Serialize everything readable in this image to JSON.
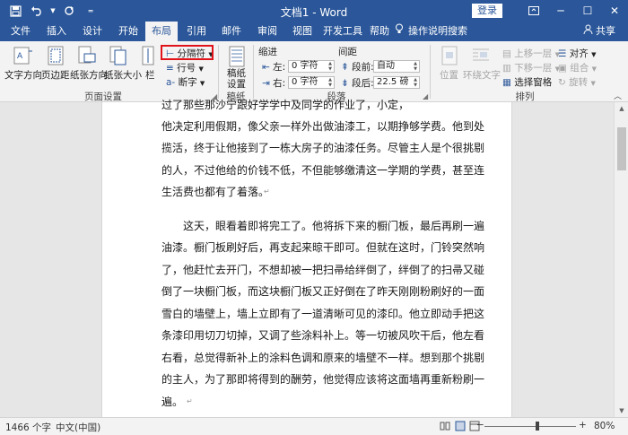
{
  "window": {
    "title": "文档1 - Word",
    "login_label": "登录"
  },
  "tabs": [
    {
      "label": "文件"
    },
    {
      "label": "插入"
    },
    {
      "label": "设计"
    },
    {
      "label": "开始"
    },
    {
      "label": "布局"
    },
    {
      "label": "引用"
    },
    {
      "label": "邮件"
    },
    {
      "label": "审阅"
    },
    {
      "label": "视图"
    },
    {
      "label": "开发工具"
    },
    {
      "label": "帮助"
    }
  ],
  "active_tab": "布局",
  "tell_me": "操作说明搜索",
  "share_label": "共享",
  "ribbon": {
    "page_setup": {
      "text_direction": "文字方向",
      "margins": "页边距",
      "orientation": "纸张方向",
      "size": "纸张大小",
      "columns": "栏",
      "breaks": "分隔符",
      "line_numbers": "行号",
      "hyphenation": "断字",
      "group_label": "页面设置"
    },
    "manuscript": {
      "button": "稿纸设置",
      "group_label": "稿纸"
    },
    "paragraph": {
      "indent_title": "缩进",
      "spacing_title": "间距",
      "left_label": "左:",
      "left_value": "0 字符",
      "right_label": "右:",
      "right_value": "0 字符",
      "before_label": "段前:",
      "before_value": "自动",
      "after_label": "段后:",
      "after_value": "22.5 磅",
      "group_label": "段落"
    },
    "arrange": {
      "position": "位置",
      "wrap_text": "环绕文字",
      "bring_forward": "上移一层",
      "send_backward": "下移一层",
      "selection_pane": "选择窗格",
      "align": "对齐",
      "group": "组合",
      "rotate": "旋转",
      "group_label": "排列"
    }
  },
  "document": {
    "lines": [
      "过了那些那沙宁跟好学学中及同学的作业了，小定，",
      "他决定利用假期，像父亲一样外出做油漆工，以期挣够学费。他到处",
      "揽活，终于让他接到了一栋大房子的油漆任务。尽管主人是个很挑剔",
      "的人，不过他给的价钱不低，不但能够缴清这一学期的学费，甚至连",
      "生活费也都有了着落。",
      "这天，眼看着即将完工了。他将拆下来的橱门板，最后再刷一遍",
      "油漆。橱门板刷好后，再支起来晾干即可。但就在这时，门铃突然响",
      "了，他赶忙去开门，不想却被一把扫帚给绊倒了，绊倒了的扫帚又碰",
      "倒了一块橱门板，而这块橱门板又正好倒在了昨天刚刚粉刷好的一面",
      "雪白的墙壁上，墙上立即有了一道清晰可见的漆印。他立即动手把这",
      "条漆印用切刀切掉，又调了些涂料补上。等一切被风吹干后，他左看",
      "右看，总觉得新补上的涂料色调和原来的墙壁不一样。想到那个挑剔",
      "的主人，为了那即将得到的酬劳，他觉得应该将这面墙再重新粉刷一",
      "遍。"
    ]
  },
  "status": {
    "word_count": "1466 个字",
    "language": "中文(中国)",
    "zoom_percent": "80%",
    "zoom_level": 0.58
  },
  "colors": {
    "title_bar": "#2b579a",
    "highlight_border": "#e0131b"
  }
}
